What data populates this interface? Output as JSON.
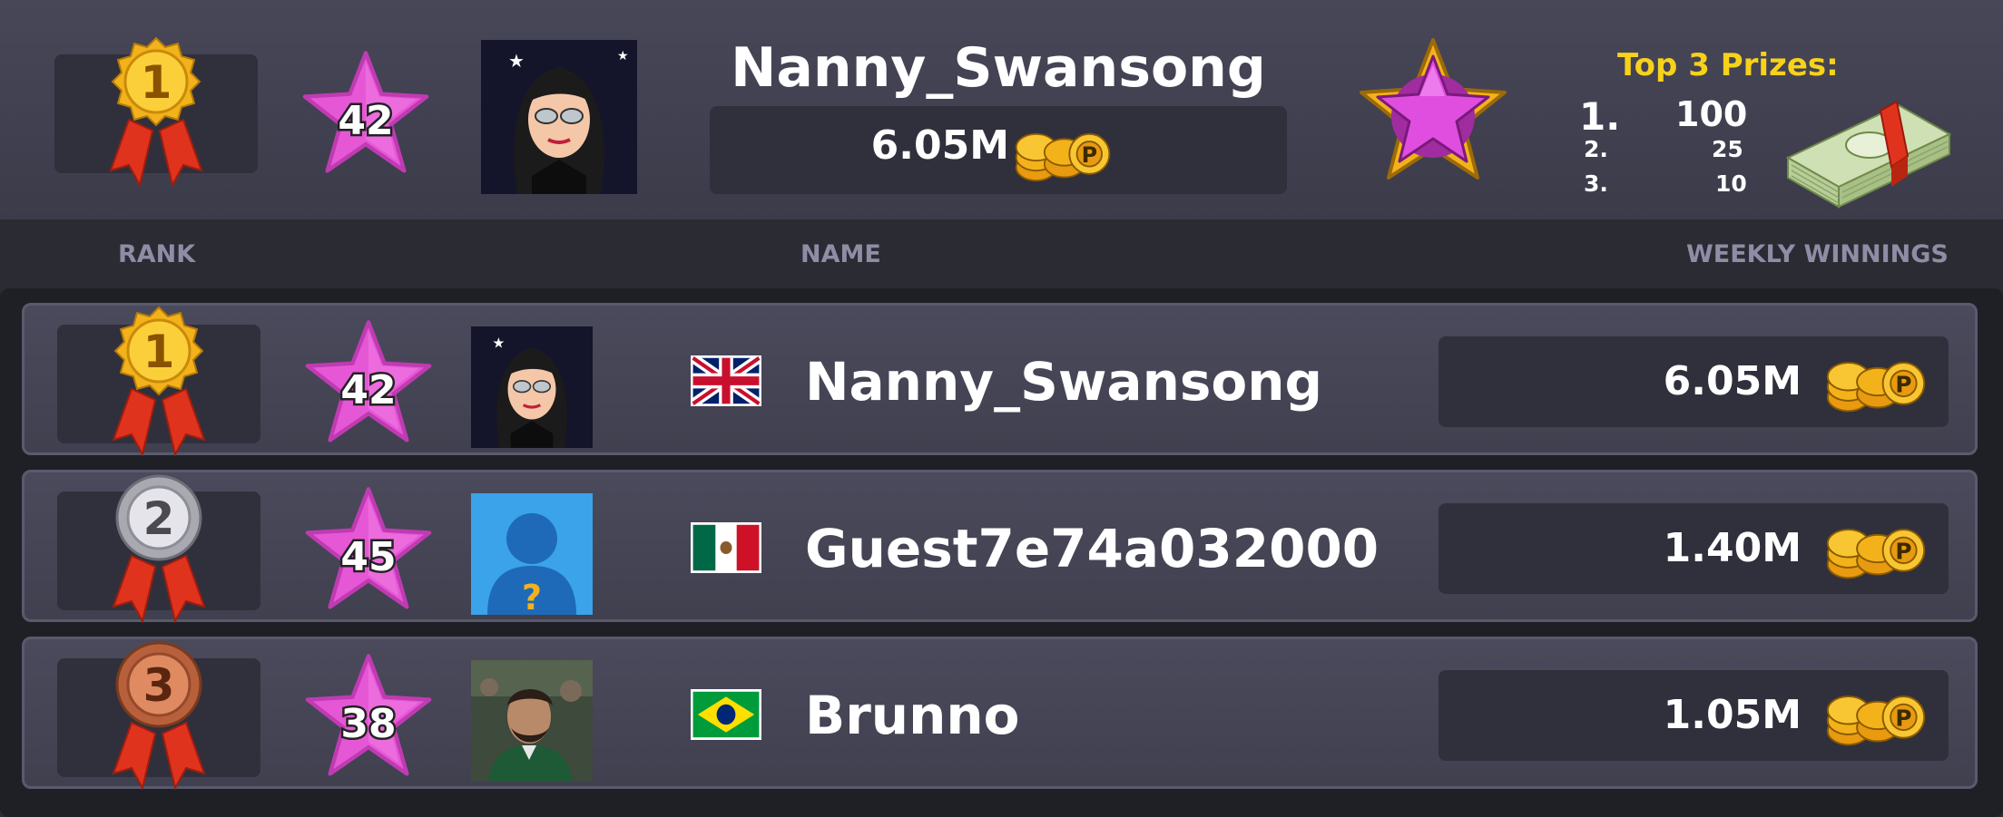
{
  "header": {
    "rank": "1",
    "level": "42",
    "player_name": "Nanny_Swansong",
    "weekly_winnings": "6.05M",
    "prizes_title": "Top 3 Prizes:",
    "prizes": [
      {
        "place": "1.",
        "amount": "100"
      },
      {
        "place": "2.",
        "amount": "25"
      },
      {
        "place": "3.",
        "amount": "10"
      }
    ],
    "league_icon": "purple-star-badge-icon",
    "prize_icon": "cash-stack-icon"
  },
  "columns": {
    "rank": "RANK",
    "name": "NAME",
    "winnings": "WEEKLY WINNINGS"
  },
  "rows": [
    {
      "rank": "1",
      "medal": "gold",
      "level": "42",
      "name": "Nanny_Swansong",
      "flag": "united-kingdom",
      "winnings": "6.05M"
    },
    {
      "rank": "2",
      "medal": "silver",
      "level": "45",
      "name": "Guest7e74a032000",
      "flag": "mexico",
      "winnings": "1.40M"
    },
    {
      "rank": "3",
      "medal": "bronze",
      "level": "38",
      "name": "Brunno",
      "flag": "brazil",
      "winnings": "1.05M"
    }
  ],
  "colors": {
    "gold": "#f2b21b",
    "silver": "#c9c9cf",
    "bronze": "#c9704a",
    "ribbon": "#e0331d",
    "star": "#e657d6",
    "prize_title": "#f7d21a",
    "panel": "#474758"
  }
}
